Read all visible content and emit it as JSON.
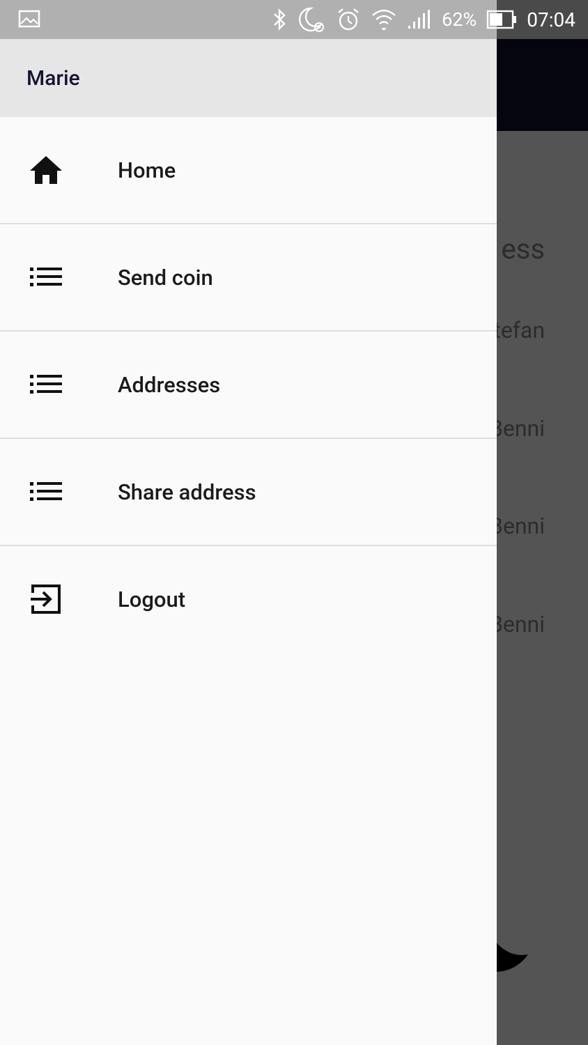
{
  "status_bar": {
    "battery_percent": "62%",
    "time": "07:04",
    "icons": [
      "image-icon",
      "bluetooth-icon",
      "do-not-disturb-icon",
      "alarm-icon",
      "wifi-icon",
      "signal-icon",
      "battery-icon"
    ]
  },
  "drawer": {
    "user_name": "Marie",
    "items": [
      {
        "label": "Home",
        "icon": "home-icon"
      },
      {
        "label": "Send coin",
        "icon": "list-icon"
      },
      {
        "label": "Addresses",
        "icon": "list-icon"
      },
      {
        "label": "Share address",
        "icon": "list-icon"
      },
      {
        "label": "Logout",
        "icon": "logout-icon"
      }
    ]
  },
  "background_screen": {
    "title_fragment": "ess",
    "rows": [
      "tefan",
      "Benni",
      "Benni",
      "Benni"
    ]
  },
  "colors": {
    "drawer_bg": "#fafafa",
    "header_bg": "#e6e6e6",
    "toolbar_bg": "#050510",
    "scrim": "#545454"
  }
}
